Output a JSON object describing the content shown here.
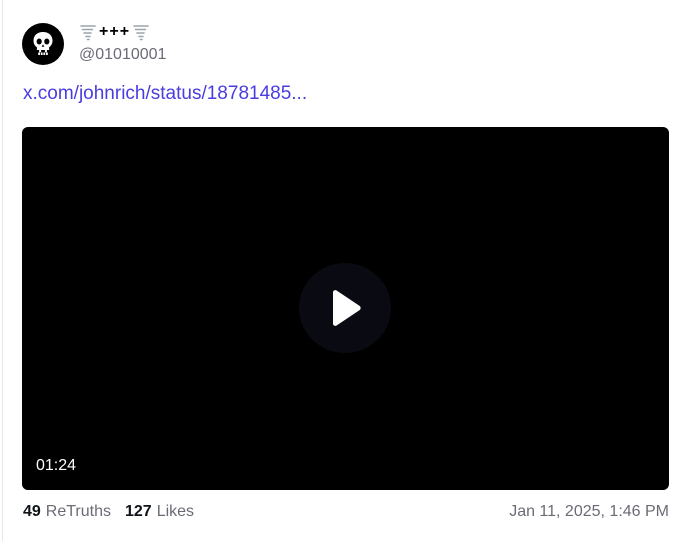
{
  "post": {
    "display_name": "+++",
    "display_name_emoji_left": "tornado-emoji",
    "display_name_emoji_right": "tornado-emoji",
    "handle": "@01010001",
    "link_text": "x.com/johnrich/status/18781485...",
    "avatar_icon": "skull-icon",
    "video": {
      "duration": "01:24",
      "play_icon": "play-icon"
    },
    "stats": {
      "retruths_count": "49",
      "retruths_label": "ReTruths",
      "likes_count": "127",
      "likes_label": "Likes"
    },
    "timestamp": "Jan 11, 2025, 1:46 PM"
  },
  "colors": {
    "link": "#4a3de0",
    "muted": "#6b6b76",
    "video_bg": "#000000"
  }
}
